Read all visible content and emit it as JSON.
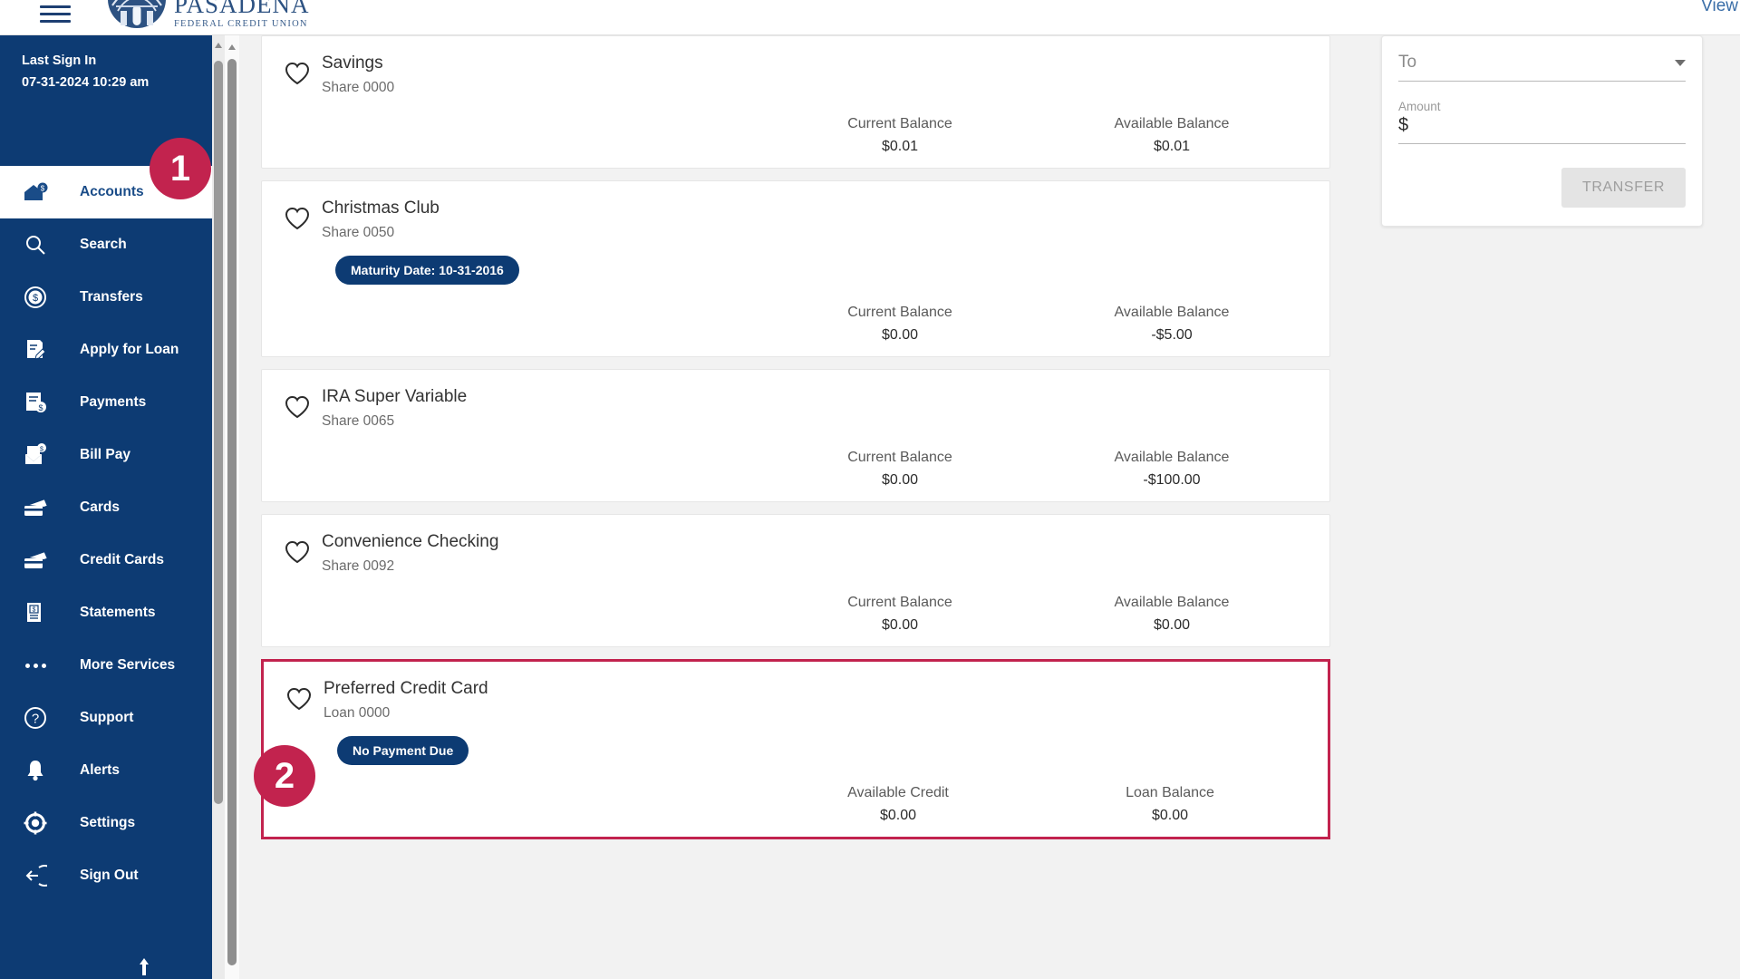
{
  "header": {
    "menu_icon": "hamburger-icon",
    "logo_name": "PASADENA",
    "logo_sub": "FEDERAL CREDIT UNION",
    "view_link": "View"
  },
  "sidebar": {
    "last_signin_label": "Last Sign In",
    "last_signin_time": "07-31-2024 10:29 am",
    "items": [
      {
        "label": "Accounts",
        "icon": "accounts-icon",
        "active": true
      },
      {
        "label": "Search",
        "icon": "search-icon",
        "active": false
      },
      {
        "label": "Transfers",
        "icon": "transfers-icon",
        "active": false
      },
      {
        "label": "Apply for Loan",
        "icon": "apply-for-loan-icon",
        "active": false
      },
      {
        "label": "Payments",
        "icon": "payments-icon",
        "active": false
      },
      {
        "label": "Bill Pay",
        "icon": "bill-pay-icon",
        "active": false
      },
      {
        "label": "Cards",
        "icon": "cards-icon",
        "active": false
      },
      {
        "label": "Credit Cards",
        "icon": "credit-cards-icon",
        "active": false
      },
      {
        "label": "Statements",
        "icon": "statements-icon",
        "active": false
      },
      {
        "label": "More Services",
        "icon": "more-services-icon",
        "active": false
      },
      {
        "label": "Support",
        "icon": "support-icon",
        "active": false
      },
      {
        "label": "Alerts",
        "icon": "alerts-bell-icon",
        "active": false
      },
      {
        "label": "Settings",
        "icon": "settings-gear-icon",
        "active": false
      },
      {
        "label": "Sign Out",
        "icon": "sign-out-icon",
        "active": false
      }
    ]
  },
  "accounts": [
    {
      "name": "Savings",
      "sub": "Share 0000",
      "badge": null,
      "left_label": "Current Balance",
      "left_value": "$0.01",
      "right_label": "Available Balance",
      "right_value": "$0.01",
      "highlighted": false
    },
    {
      "name": "Christmas Club",
      "sub": "Share 0050",
      "badge": "Maturity Date: 10-31-2016",
      "left_label": "Current Balance",
      "left_value": "$0.00",
      "right_label": "Available Balance",
      "right_value": "-$5.00",
      "highlighted": false
    },
    {
      "name": "IRA Super Variable",
      "sub": "Share 0065",
      "badge": null,
      "left_label": "Current Balance",
      "left_value": "$0.00",
      "right_label": "Available Balance",
      "right_value": "-$100.00",
      "highlighted": false
    },
    {
      "name": "Convenience Checking",
      "sub": "Share 0092",
      "badge": null,
      "left_label": "Current Balance",
      "left_value": "$0.00",
      "right_label": "Available Balance",
      "right_value": "$0.00",
      "highlighted": false
    },
    {
      "name": "Preferred Credit Card",
      "sub": "Loan 0000",
      "badge": "No Payment Due",
      "left_label": "Available Credit",
      "left_value": "$0.00",
      "right_label": "Loan Balance",
      "right_value": "$0.00",
      "highlighted": true
    }
  ],
  "transfer": {
    "to_placeholder": "To",
    "amount_label": "Amount",
    "amount_symbol": "$",
    "amount_value": "",
    "transfer_button": "TRANSFER"
  },
  "callouts": [
    {
      "number": "1"
    },
    {
      "number": "2"
    }
  ],
  "colors": {
    "brand_navy": "#0d3b73",
    "callout_crimson": "#c2234e",
    "logo_blue": "#2d5282"
  }
}
